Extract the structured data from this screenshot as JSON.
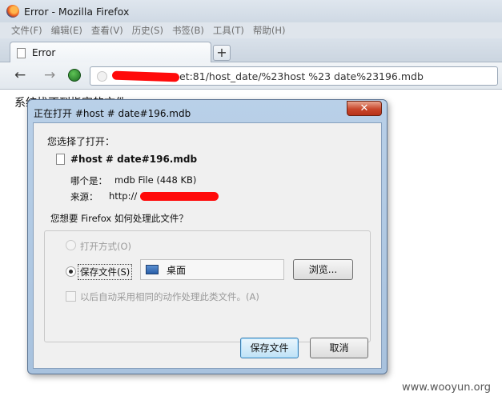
{
  "window": {
    "title": "Error - Mozilla Firefox"
  },
  "menu": {
    "items": [
      "文件(F)",
      "编辑(E)",
      "查看(V)",
      "历史(S)",
      "书签(B)",
      "工具(T)",
      "帮助(H)"
    ]
  },
  "tab": {
    "label": "Error",
    "new_tab": "+"
  },
  "nav": {
    "back": "←",
    "forward": "→",
    "url_visible": "et:81/host_date/%23host %23 date%23196.mdb"
  },
  "page": {
    "text": "系统找不到指定的文件"
  },
  "dialog": {
    "title": "正在打开 #host # date#196.mdb",
    "close": "✕",
    "intro": "您选择了打开：",
    "file_name": "#host # date#196.mdb",
    "type_label": "哪个是：",
    "type_value": "mdb File (448 KB)",
    "from_label": "来源：",
    "from_value": "http://",
    "question": "您想要 Firefox 如何处理此文件？",
    "open_with": "打开方式(O)",
    "save_file": "保存文件(S)",
    "location": "桌面",
    "browse": "浏览...",
    "remember": "以后自动采用相同的动作处理此类文件。(A)",
    "ok": "保存文件",
    "cancel": "取消"
  },
  "watermark": "www.wooyun.org"
}
